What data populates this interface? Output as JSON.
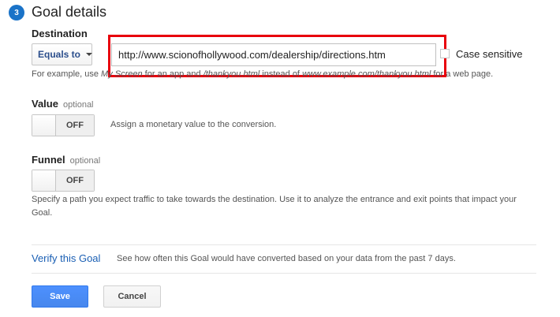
{
  "header": {
    "step_number": "3",
    "title": "Goal details"
  },
  "destination": {
    "label": "Destination",
    "match_type": "Equals to",
    "url_value": "http://www.scionofhollywood.com/dealership/directions.htm",
    "case_sensitive_label": "Case sensitive",
    "case_sensitive_checked": false,
    "help": {
      "prefix": "For example, use ",
      "example_app": "My Screen",
      "middle1": " for an app and ",
      "example_page": "/thankyou.html",
      "middle2": " instead of ",
      "example_url": "www.example.com/thankyou.html",
      "suffix": " for a web page."
    }
  },
  "value": {
    "label": "Value",
    "optional": "optional",
    "toggle_state": "OFF",
    "description": "Assign a monetary value to the conversion."
  },
  "funnel": {
    "label": "Funnel",
    "optional": "optional",
    "toggle_state": "OFF",
    "description": "Specify a path you expect traffic to take towards the destination. Use it to analyze the entrance and exit points that impact your Goal."
  },
  "verify": {
    "link_label": "Verify this Goal",
    "description": "See how often this Goal would have converted based on your data from the past 7 days."
  },
  "actions": {
    "save_label": "Save",
    "cancel_label": "Cancel"
  },
  "colors": {
    "accent": "#1a73c8",
    "highlight": "#e8000c",
    "save_button": "#4d90fe",
    "link": "#1a5fb4"
  }
}
